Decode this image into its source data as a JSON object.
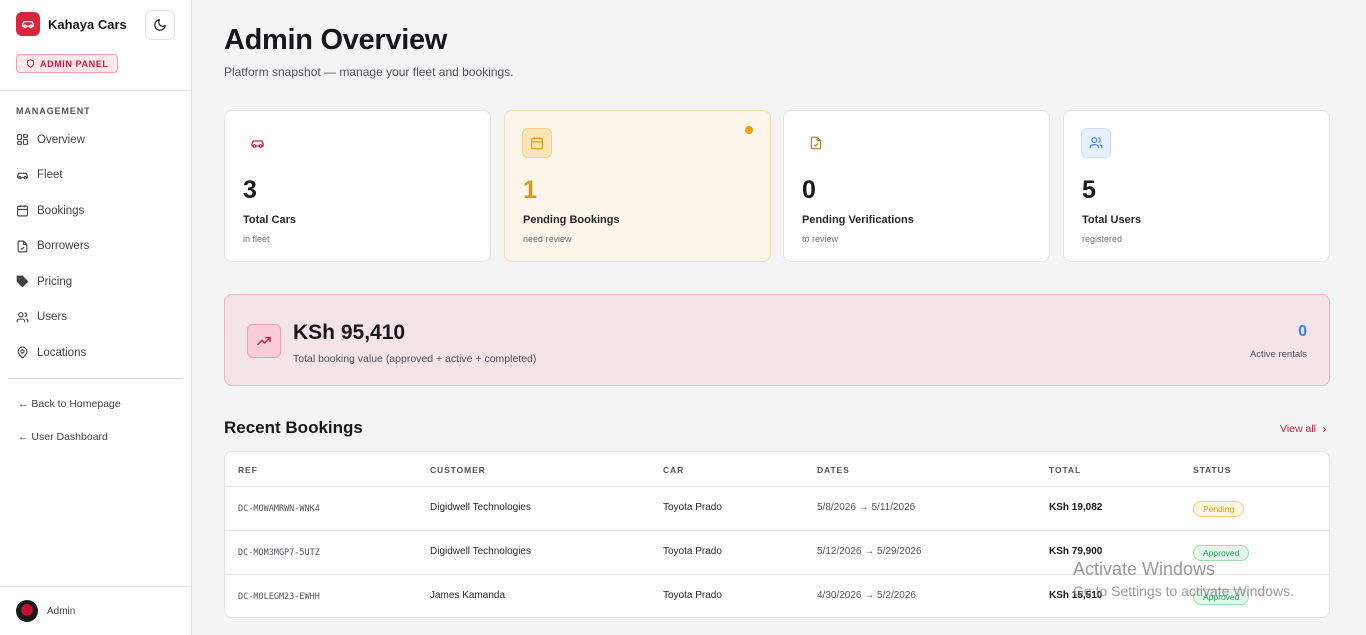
{
  "brand": {
    "name": "Kahaya Cars",
    "badge": "ADMIN PANEL"
  },
  "sidebar": {
    "section_label": "MANAGEMENT",
    "items": [
      {
        "label": "Overview",
        "icon": "grid-icon"
      },
      {
        "label": "Fleet",
        "icon": "car-icon"
      },
      {
        "label": "Bookings",
        "icon": "calendar-icon"
      },
      {
        "label": "Borrowers",
        "icon": "file-check-icon"
      },
      {
        "label": "Pricing",
        "icon": "tag-icon"
      },
      {
        "label": "Users",
        "icon": "users-icon"
      },
      {
        "label": "Locations",
        "icon": "map-pin-icon"
      }
    ],
    "back_home": "← Back to Homepage",
    "user_dashboard": "← User Dashboard",
    "user": {
      "name": "Admin"
    }
  },
  "header": {
    "title": "Admin Overview",
    "subtitle": "Platform snapshot — manage your fleet and bookings."
  },
  "stats": [
    {
      "value": "3",
      "label": "Total Cars",
      "sub": "in fleet",
      "icon": "car-icon",
      "color": "#c8203a"
    },
    {
      "value": "1",
      "label": "Pending Bookings",
      "sub": "need review",
      "icon": "calendar-icon",
      "color": "#d99a0b"
    },
    {
      "value": "0",
      "label": "Pending Verifications",
      "sub": "to review",
      "icon": "file-check-icon",
      "color": "#b7791f"
    },
    {
      "value": "5",
      "label": "Total Users",
      "sub": "registered",
      "icon": "users-icon",
      "color": "#3b82f6"
    }
  ],
  "revenue": {
    "value": "KSh 95,410",
    "sub": "Total booking value (approved + active + completed)",
    "active_count": "0",
    "active_label": "Active rentals"
  },
  "recent": {
    "title": "Recent Bookings",
    "view_all": "View all",
    "columns": [
      "REF",
      "CUSTOMER",
      "CAR",
      "DATES",
      "TOTAL",
      "STATUS"
    ],
    "rows": [
      {
        "ref": "DC-MOWAMRWN-WNK4",
        "customer": "Digidwell Technologies",
        "car": "Toyota Prado",
        "dates": "5/8/2026 → 5/11/2026",
        "total": "KSh 19,082",
        "status": "Pending"
      },
      {
        "ref": "DC-MOM3MGP7-5UTZ",
        "customer": "Digidwell Technologies",
        "car": "Toyota Prado",
        "dates": "5/12/2026 → 5/29/2026",
        "total": "KSh 79,900",
        "status": "Approved"
      },
      {
        "ref": "DC-MOLEGM23-EWHH",
        "customer": "James Kamanda",
        "car": "Toyota Prado",
        "dates": "4/30/2026 → 5/2/2026",
        "total": "KSh 15,510",
        "status": "Approved"
      }
    ]
  },
  "watermark": {
    "title": "Activate Windows",
    "sub": "Go to Settings to activate Windows."
  }
}
